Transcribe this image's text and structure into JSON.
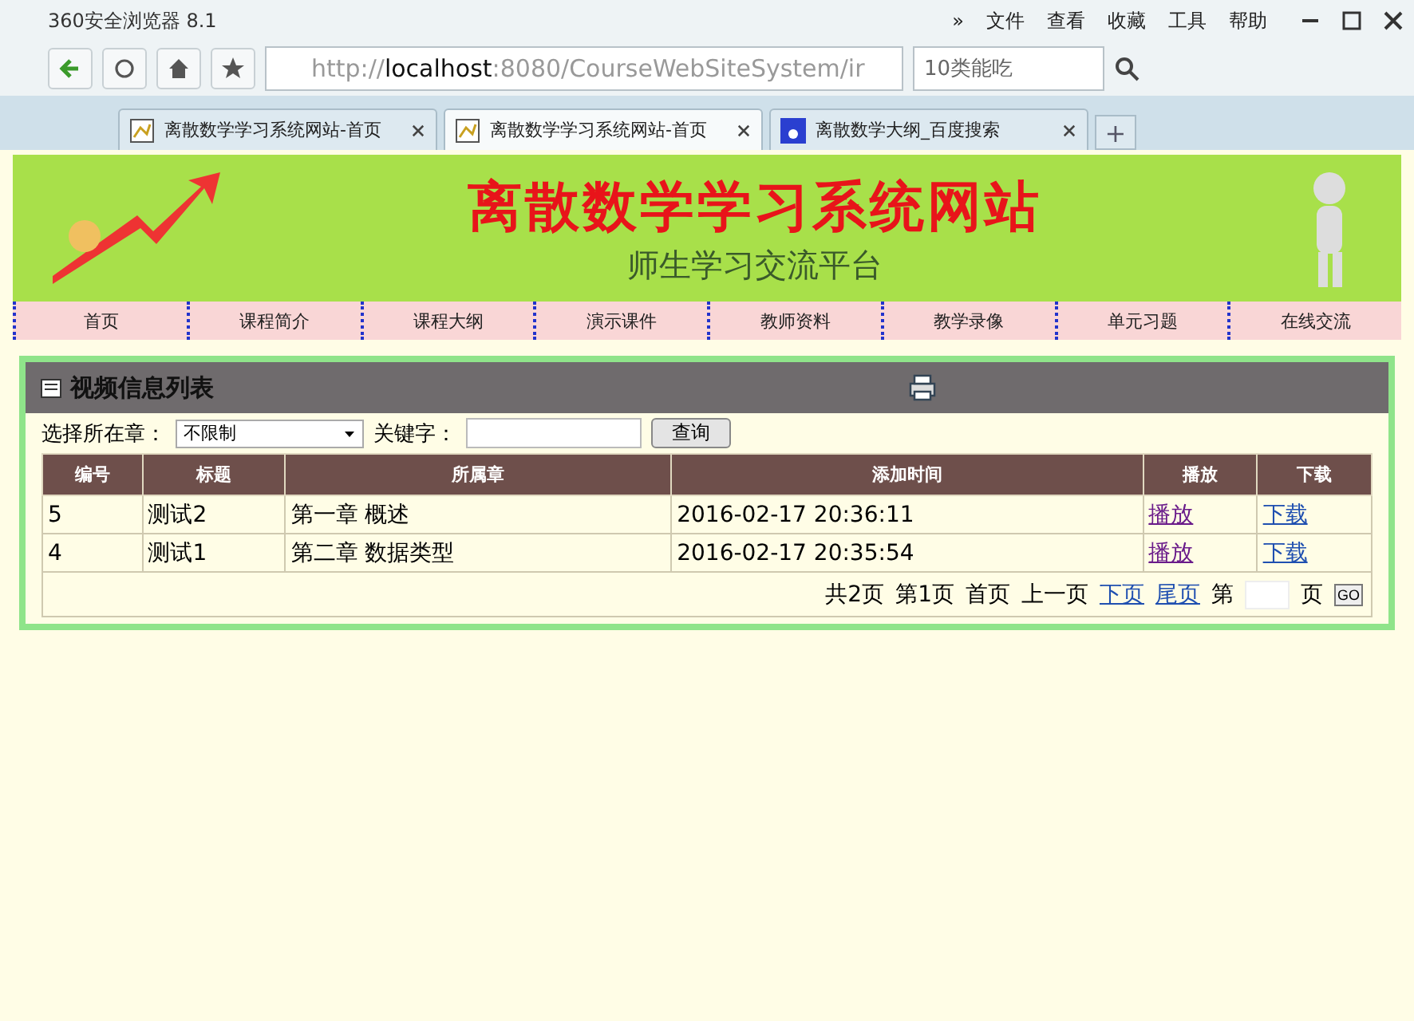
{
  "browser": {
    "title": "360安全浏览器 8.1",
    "menu": [
      "»",
      "文件",
      "查看",
      "收藏",
      "工具",
      "帮助"
    ],
    "address_host": "http://",
    "address_bold": "localhost",
    "address_rest": ":8080/CourseWebSiteSystem/ir",
    "search_value": "10类能吃",
    "tabs": [
      {
        "label": "离散数学学习系统网站-首页",
        "selected": false,
        "kind": "site"
      },
      {
        "label": "离散数学学习系统网站-首页",
        "selected": true,
        "kind": "site"
      },
      {
        "label": "离散数学大纲_百度搜索",
        "selected": false,
        "kind": "search"
      }
    ],
    "new_tab": "+"
  },
  "header": {
    "title": "离散数学学习系统网站",
    "subtitle": "师生学习交流平台"
  },
  "nav": [
    "首页",
    "课程简介",
    "课程大纲",
    "演示课件",
    "教师资料",
    "教学录像",
    "单元习题",
    "在线交流"
  ],
  "panel": {
    "title": "视频信息列表",
    "chapter_label": "选择所在章：",
    "chapter_value": "不限制",
    "keyword_label": "关键字：",
    "search_button": "查询",
    "columns": [
      "编号",
      "标题",
      "所属章",
      "添加时间",
      "播放",
      "下载"
    ],
    "rows": [
      {
        "cells": [
          "5",
          "测试2",
          "第一章  概述",
          "2016-02-17 20:36:11"
        ],
        "play": "播放",
        "download": "下载"
      },
      {
        "cells": [
          "4",
          "测试1",
          "第二章  数据类型",
          "2016-02-17 20:35:54"
        ],
        "play": "播放",
        "download": "下载"
      }
    ],
    "pager": [
      {
        "kind": "text",
        "label": "共2页"
      },
      {
        "kind": "text",
        "label": "第1页"
      },
      {
        "kind": "text",
        "label": "首页"
      },
      {
        "kind": "text",
        "label": "上一页"
      },
      {
        "kind": "link",
        "label": "下页"
      },
      {
        "kind": "link",
        "label": "尾页"
      }
    ],
    "page_label_before": "第",
    "page_label_after": "页",
    "go_button": "GO"
  }
}
